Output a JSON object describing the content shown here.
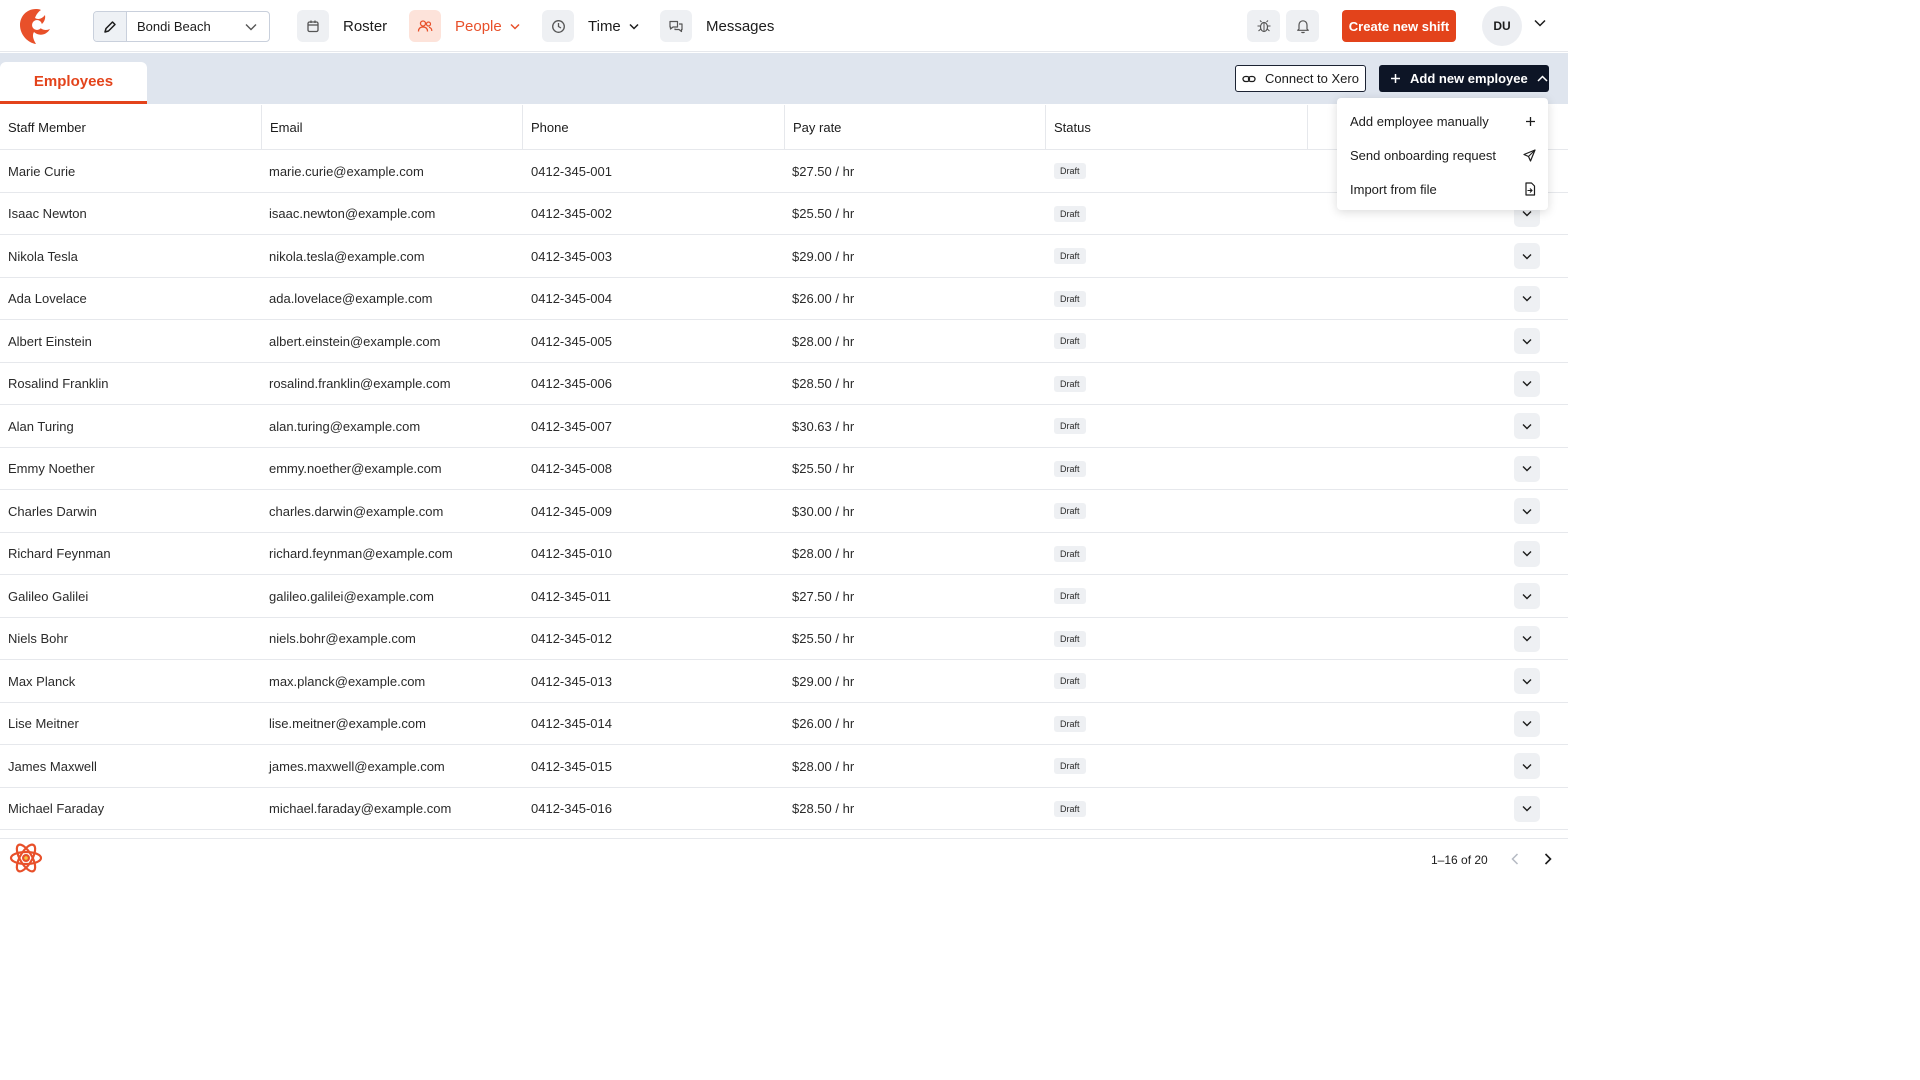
{
  "nav": {
    "location": "Bondi Beach",
    "items": [
      {
        "label": "Roster",
        "icon": "calendar-icon"
      },
      {
        "label": "People",
        "icon": "people-icon"
      },
      {
        "label": "Time",
        "icon": "clock-icon"
      },
      {
        "label": "Messages",
        "icon": "chat-icon"
      }
    ],
    "create_shift": "Create new shift",
    "avatar_initials": "DU"
  },
  "tabs": [
    {
      "label": "Employees"
    }
  ],
  "actions": {
    "connect_xero": "Connect to Xero",
    "add_employee": "Add new employee"
  },
  "dropdown": {
    "items": [
      {
        "label": "Add employee manually",
        "icon": "plus-icon"
      },
      {
        "label": "Send onboarding request",
        "icon": "send-icon"
      },
      {
        "label": "Import from file",
        "icon": "file-import-icon"
      }
    ]
  },
  "table": {
    "columns": [
      "Staff Member",
      "Email",
      "Phone",
      "Pay rate",
      "Status"
    ],
    "rows": [
      {
        "name": "Marie Curie",
        "email": "marie.curie@example.com",
        "phone": "0412-345-001",
        "rate": "$27.50 / hr",
        "status": "Draft"
      },
      {
        "name": "Isaac Newton",
        "email": "isaac.newton@example.com",
        "phone": "0412-345-002",
        "rate": "$25.50 / hr",
        "status": "Draft"
      },
      {
        "name": "Nikola Tesla",
        "email": "nikola.tesla@example.com",
        "phone": "0412-345-003",
        "rate": "$29.00 / hr",
        "status": "Draft"
      },
      {
        "name": "Ada Lovelace",
        "email": "ada.lovelace@example.com",
        "phone": "0412-345-004",
        "rate": "$26.00 / hr",
        "status": "Draft"
      },
      {
        "name": "Albert Einstein",
        "email": "albert.einstein@example.com",
        "phone": "0412-345-005",
        "rate": "$28.00 / hr",
        "status": "Draft"
      },
      {
        "name": "Rosalind Franklin",
        "email": "rosalind.franklin@example.com",
        "phone": "0412-345-006",
        "rate": "$28.50 / hr",
        "status": "Draft"
      },
      {
        "name": "Alan Turing",
        "email": "alan.turing@example.com",
        "phone": "0412-345-007",
        "rate": "$30.63 / hr",
        "status": "Draft"
      },
      {
        "name": "Emmy Noether",
        "email": "emmy.noether@example.com",
        "phone": "0412-345-008",
        "rate": "$25.50 / hr",
        "status": "Draft"
      },
      {
        "name": "Charles Darwin",
        "email": "charles.darwin@example.com",
        "phone": "0412-345-009",
        "rate": "$30.00 / hr",
        "status": "Draft"
      },
      {
        "name": "Richard Feynman",
        "email": "richard.feynman@example.com",
        "phone": "0412-345-010",
        "rate": "$28.00 / hr",
        "status": "Draft"
      },
      {
        "name": "Galileo Galilei",
        "email": "galileo.galilei@example.com",
        "phone": "0412-345-011",
        "rate": "$27.50 / hr",
        "status": "Draft"
      },
      {
        "name": "Niels Bohr",
        "email": "niels.bohr@example.com",
        "phone": "0412-345-012",
        "rate": "$25.50 / hr",
        "status": "Draft"
      },
      {
        "name": "Max Planck",
        "email": "max.planck@example.com",
        "phone": "0412-345-013",
        "rate": "$29.00 / hr",
        "status": "Draft"
      },
      {
        "name": "Lise Meitner",
        "email": "lise.meitner@example.com",
        "phone": "0412-345-014",
        "rate": "$26.00 / hr",
        "status": "Draft"
      },
      {
        "name": "James Maxwell",
        "email": "james.maxwell@example.com",
        "phone": "0412-345-015",
        "rate": "$28.00 / hr",
        "status": "Draft"
      },
      {
        "name": "Michael Faraday",
        "email": "michael.faraday@example.com",
        "phone": "0412-345-016",
        "rate": "$28.50 / hr",
        "status": "Draft"
      }
    ]
  },
  "pagination": {
    "summary": "1–16 of 20"
  },
  "colors": {
    "accent": "#e3431b",
    "dark_button": "#0d1526",
    "tab_bar": "#dfe5ee"
  }
}
